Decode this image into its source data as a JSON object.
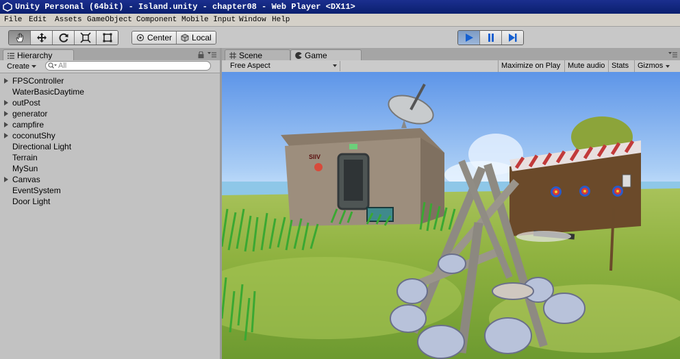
{
  "window": {
    "title": "Unity Personal (64bit) - Island.unity - chapter08 - Web Player <DX11>"
  },
  "menu": [
    "File",
    "Edit",
    "Assets",
    "GameObject",
    "Component",
    "Mobile Input",
    "Window",
    "Help"
  ],
  "toolbar": {
    "tools": [
      "hand-icon",
      "move-icon",
      "rotate-icon",
      "scale-icon",
      "rect-icon"
    ],
    "pivot_center": "Center",
    "pivot_local": "Local",
    "play_controls": [
      "play-icon",
      "pause-icon",
      "step-icon"
    ]
  },
  "hierarchy": {
    "tab": "Hierarchy",
    "create": "Create",
    "search_placeholder": "All",
    "items": [
      {
        "label": "FPSController",
        "expandable": true
      },
      {
        "label": "WaterBasicDaytime",
        "expandable": false
      },
      {
        "label": "outPost",
        "expandable": true
      },
      {
        "label": "generator",
        "expandable": true
      },
      {
        "label": "campfire",
        "expandable": true
      },
      {
        "label": "coconutShy",
        "expandable": true
      },
      {
        "label": "Directional Light",
        "expandable": false
      },
      {
        "label": "Terrain",
        "expandable": false
      },
      {
        "label": "MySun",
        "expandable": false
      },
      {
        "label": "Canvas",
        "expandable": true
      },
      {
        "label": "EventSystem",
        "expandable": false
      },
      {
        "label": "Door Light",
        "expandable": false
      }
    ]
  },
  "game_panel": {
    "tab_scene": "Scene",
    "tab_game": "Game",
    "aspect": "Free Aspect",
    "maximize": "Maximize on Play",
    "mute": "Mute audio",
    "stats": "Stats",
    "gizmos": "Gizmos"
  },
  "scene_sign": "SIIV",
  "colors": {
    "title_bar": "#0a1f6e",
    "play_active": "#8aa6ce",
    "panel_bg": "#c2c2c2"
  }
}
